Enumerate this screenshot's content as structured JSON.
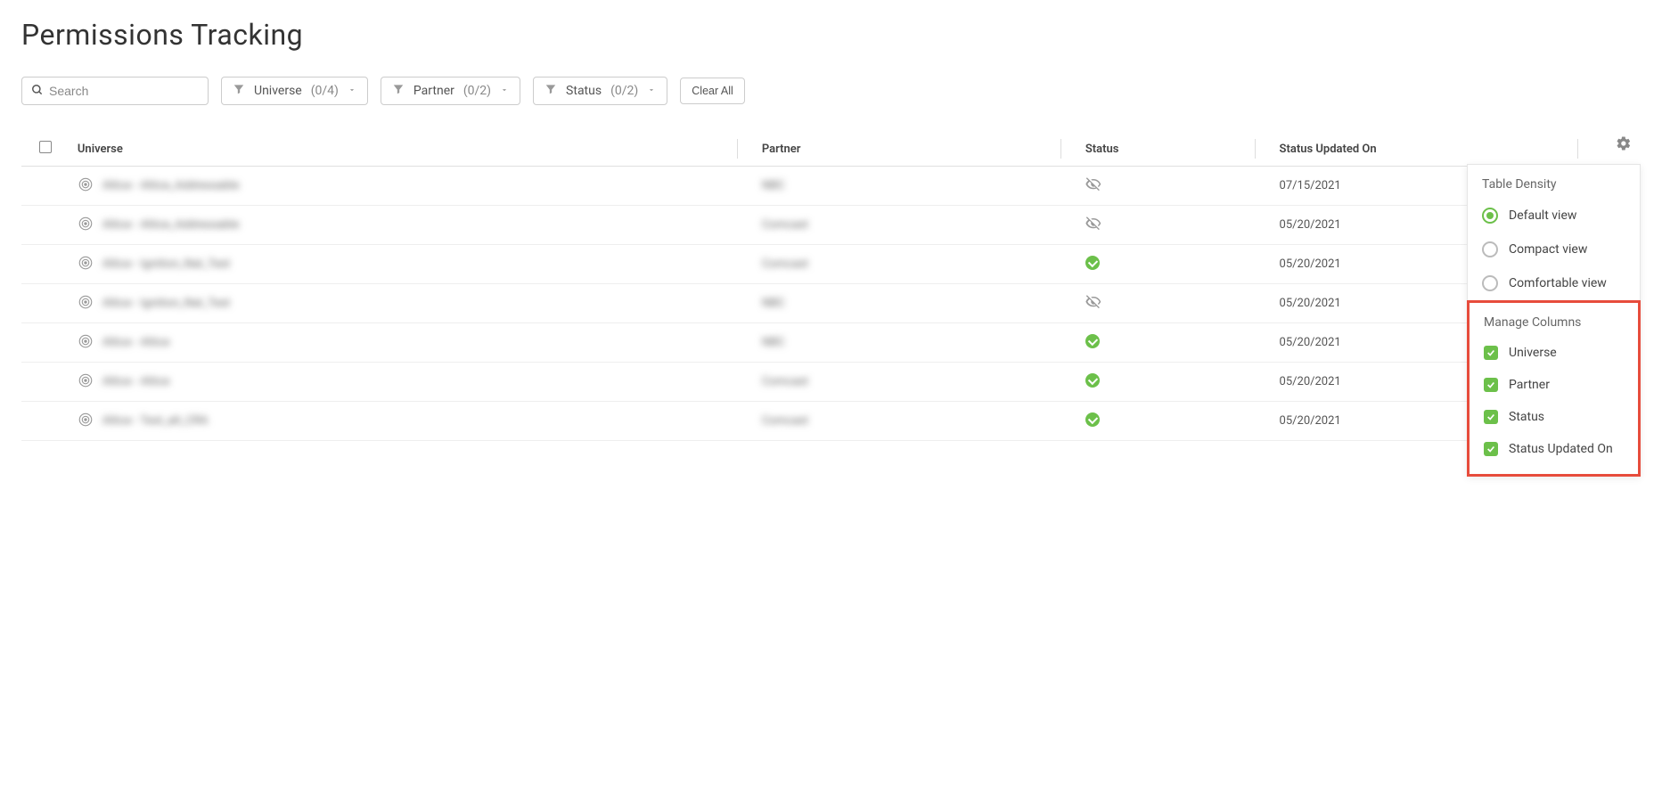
{
  "page_title": "Permissions Tracking",
  "search": {
    "placeholder": "Search"
  },
  "filters": [
    {
      "label": "Universe",
      "count": "(0/4)"
    },
    {
      "label": "Partner",
      "count": "(0/2)"
    },
    {
      "label": "Status",
      "count": "(0/2)"
    }
  ],
  "clear_all_label": "Clear All",
  "columns": {
    "universe": "Universe",
    "partner": "Partner",
    "status": "Status",
    "updated": "Status Updated On"
  },
  "rows": [
    {
      "universe": "Altice - Altice_Addressable",
      "partner": "NBC",
      "status": "gray",
      "updated": "07/15/2021"
    },
    {
      "universe": "Altice - Altice_Addressable",
      "partner": "Comcast",
      "status": "gray",
      "updated": "05/20/2021"
    },
    {
      "universe": "Altice - Ignition_Nat_Test",
      "partner": "Comcast",
      "status": "green",
      "updated": "05/20/2021"
    },
    {
      "universe": "Altice - Ignition_Nat_Test",
      "partner": "NBC",
      "status": "gray",
      "updated": "05/20/2021"
    },
    {
      "universe": "Altice - Altice",
      "partner": "NBC",
      "status": "green",
      "updated": "05/20/2021"
    },
    {
      "universe": "Altice - Altice",
      "partner": "Comcast",
      "status": "green",
      "updated": "05/20/2021"
    },
    {
      "universe": "Altice - Test_alt_CRA",
      "partner": "Comcast",
      "status": "green",
      "updated": "05/20/2021"
    }
  ],
  "settings_panel": {
    "density_title": "Table Density",
    "density_options": [
      {
        "label": "Default view",
        "selected": true
      },
      {
        "label": "Compact view",
        "selected": false
      },
      {
        "label": "Comfortable view",
        "selected": false
      }
    ],
    "manage_title": "Manage Columns",
    "manage_columns": [
      {
        "label": "Universe",
        "checked": true
      },
      {
        "label": "Partner",
        "checked": true
      },
      {
        "label": "Status",
        "checked": true
      },
      {
        "label": "Status Updated On",
        "checked": true
      }
    ]
  }
}
